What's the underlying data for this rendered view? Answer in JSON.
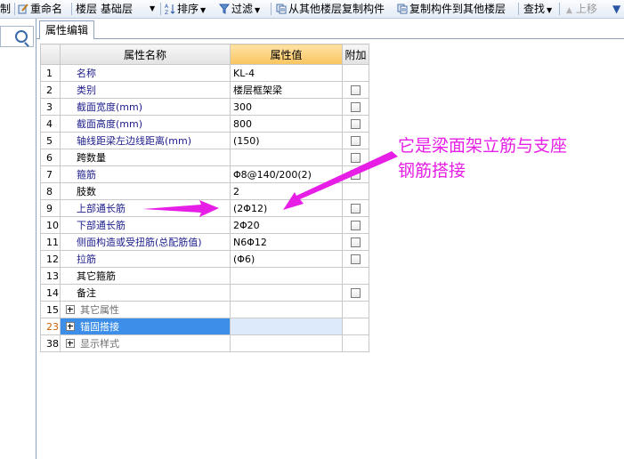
{
  "toolbar": {
    "items": [
      {
        "label": "制",
        "icon": "copy-icon"
      },
      {
        "label": "重命名",
        "icon": "rename-icon"
      },
      {
        "label": "楼层",
        "icon": ""
      },
      {
        "label": "基础层",
        "icon": "dropdown-icon"
      },
      {
        "label": "排序",
        "icon": "sort-icon"
      },
      {
        "label": "过滤",
        "icon": "filter-icon"
      },
      {
        "label": "从其他楼层复制构件",
        "icon": "copy-from-floor-icon"
      },
      {
        "label": "复制构件到其他楼层",
        "icon": "copy-to-floor-icon"
      },
      {
        "label": "查找",
        "icon": "find-icon"
      },
      {
        "label": "上移",
        "icon": "up-arrow-icon"
      }
    ]
  },
  "tab": {
    "label": "属性编辑"
  },
  "grid": {
    "headers": {
      "name": "属性名称",
      "value": "属性值",
      "extra": "附加"
    },
    "rows": [
      {
        "num": "1",
        "name": "名称",
        "value": "KL-4",
        "check": false
      },
      {
        "num": "2",
        "name": "类别",
        "value": "楼层框架梁",
        "check": true
      },
      {
        "num": "3",
        "name": "截面宽度(mm)",
        "value": "300",
        "check": true
      },
      {
        "num": "4",
        "name": "截面高度(mm)",
        "value": "800",
        "check": true
      },
      {
        "num": "5",
        "name": "轴线距梁左边线距离(mm)",
        "value": "(150)",
        "check": true
      },
      {
        "num": "6",
        "name": "跨数量",
        "value": "",
        "check": true
      },
      {
        "num": "7",
        "name": "箍筋",
        "value": "Φ8@140/200(2)",
        "check": true
      },
      {
        "num": "8",
        "name": "肢数",
        "value": "2",
        "check": false
      },
      {
        "num": "9",
        "name": "上部通长筋",
        "value": "(2Φ12)",
        "check": true
      },
      {
        "num": "10",
        "name": "下部通长筋",
        "value": "2Φ20",
        "check": true
      },
      {
        "num": "11",
        "name": "侧面构造或受扭筋(总配筋值)",
        "value": "N6Φ12",
        "check": true
      },
      {
        "num": "12",
        "name": "拉筋",
        "value": "(Φ6)",
        "check": true
      },
      {
        "num": "13",
        "name": "其它箍筋",
        "value": "",
        "check": false
      },
      {
        "num": "14",
        "name": "备注",
        "value": "",
        "check": true
      }
    ],
    "groups": [
      {
        "num": "15",
        "label": "其它属性",
        "selected": false
      },
      {
        "num": "23",
        "label": "锚固搭接",
        "selected": true
      },
      {
        "num": "38",
        "label": "显示样式",
        "selected": false
      }
    ]
  },
  "annotation": {
    "line1": "它是梁面架立筋与支座",
    "line2": "钢筋搭接",
    "color": "#e61ee6"
  }
}
